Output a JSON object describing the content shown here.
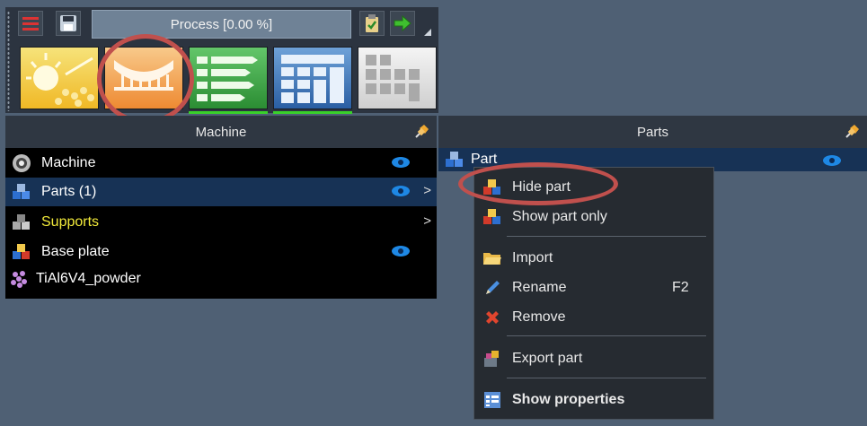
{
  "toolbar": {
    "progress_label": "Process [0.00 %]",
    "tiles": [
      "laser-exposure-icon",
      "support-design-icon",
      "slicing-icon",
      "build-layout-icon",
      "report-icon"
    ]
  },
  "machine_panel": {
    "header": "Machine",
    "items": [
      {
        "label": "Machine",
        "icon": "machine-gear-icon",
        "visible": true,
        "submenu": false
      },
      {
        "label": "Parts (1)",
        "icon": "parts-cubes-icon",
        "visible": true,
        "submenu": true,
        "selected": true
      },
      {
        "label": "Supports",
        "icon": "supports-cubes-icon",
        "visible": false,
        "submenu": true,
        "color": "#f1e93a"
      },
      {
        "label": "Base plate",
        "icon": "base-plate-icon",
        "visible": true,
        "submenu": false
      },
      {
        "label": "TiAl6V4_powder",
        "icon": "powder-icon",
        "visible": false,
        "submenu": false
      }
    ]
  },
  "parts_panel": {
    "header": "Parts",
    "item_label": "Part"
  },
  "context_menu": {
    "items": [
      {
        "label": "Hide part",
        "icon": "hide-part-icon",
        "shortcut": ""
      },
      {
        "label": "Show part only",
        "icon": "show-part-only-icon",
        "shortcut": ""
      },
      {
        "label": "Import",
        "icon": "folder-import-icon",
        "shortcut": ""
      },
      {
        "label": "Rename",
        "icon": "pencil-icon",
        "shortcut": "F2"
      },
      {
        "label": "Remove",
        "icon": "remove-x-icon",
        "shortcut": ""
      },
      {
        "label": "Export part",
        "icon": "export-part-icon",
        "shortcut": ""
      },
      {
        "label": "Show properties",
        "icon": "properties-icon",
        "shortcut": ""
      }
    ]
  },
  "colors": {
    "background": "#4f6074",
    "selection": "#173255",
    "highlight_ellipse": "#c0504d",
    "supports_text": "#f1e93a",
    "eye": "#1e88e5"
  }
}
